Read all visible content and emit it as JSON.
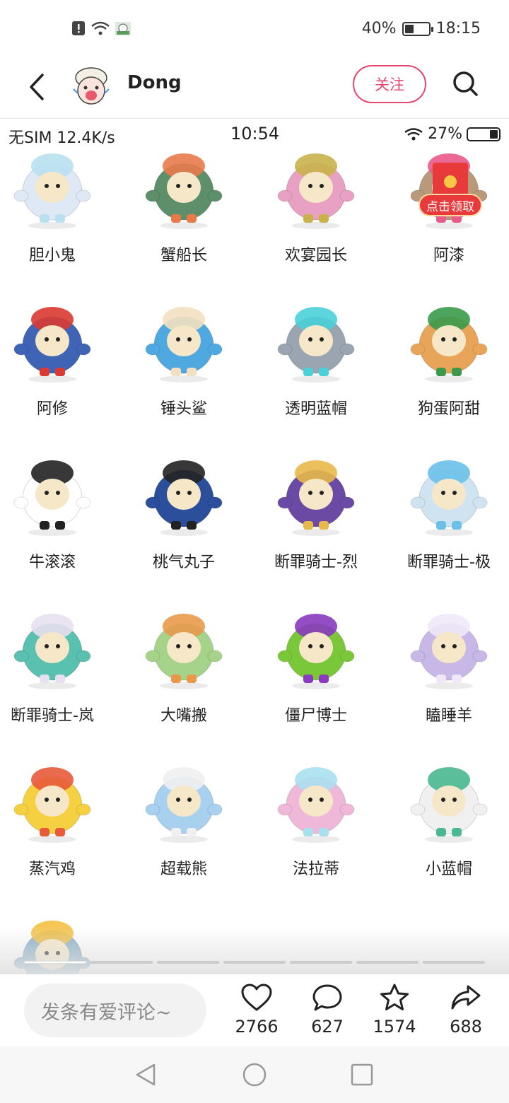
{
  "status_bar": {
    "battery": "40%",
    "time": "18:15",
    "battery_level": 0.4,
    "icons": [
      "alert-icon",
      "wifi-icon",
      "app-notification-icon"
    ]
  },
  "header": {
    "username": "Dong",
    "follow_label": "关注"
  },
  "inner_status": {
    "carrier": "无SIM 12.4K/s",
    "time": "10:54",
    "battery": "27%",
    "battery_level": 0.27
  },
  "characters": [
    {
      "name": "胆小鬼",
      "color": "#dfe9f5",
      "accent": "#b8e0ef"
    },
    {
      "name": "蟹船长",
      "color": "#5d8f6a",
      "accent": "#e87a4a"
    },
    {
      "name": "欢宴园长",
      "color": "#e8a1c3",
      "accent": "#c9b24a"
    },
    {
      "name": "阿漆",
      "color": "#b89a7a",
      "accent": "#e85a8a"
    },
    {
      "name": "阿修",
      "color": "#3f63b5",
      "accent": "#d93a32"
    },
    {
      "name": "锤头鲨",
      "color": "#4fa8e0",
      "accent": "#f3e0c0"
    },
    {
      "name": "透明蓝帽",
      "color": "#9aa5b1",
      "accent": "#4ad0d8"
    },
    {
      "name": "狗蛋阿甜",
      "color": "#e8a55a",
      "accent": "#3a9a4a"
    },
    {
      "name": "牛滚滚",
      "color": "#ffffff",
      "accent": "#222222"
    },
    {
      "name": "桃气丸子",
      "color": "#2b4f9a",
      "accent": "#222222"
    },
    {
      "name": "断罪骑士-烈",
      "color": "#6a4aa5",
      "accent": "#e8b84a"
    },
    {
      "name": "断罪骑士-极",
      "color": "#cfe3f0",
      "accent": "#6ac0e8"
    },
    {
      "name": "断罪骑士-岚",
      "color": "#5ac0b0",
      "accent": "#e8e0f0"
    },
    {
      "name": "大嘴搬",
      "color": "#a5d38a",
      "accent": "#e89a4a"
    },
    {
      "name": "僵尸博士",
      "color": "#7ac83a",
      "accent": "#8a3ac0"
    },
    {
      "name": "瞌睡羊",
      "color": "#c8b8e8",
      "accent": "#f0e8f8"
    },
    {
      "name": "蒸汽鸡",
      "color": "#f5d040",
      "accent": "#e85a3a"
    },
    {
      "name": "超载熊",
      "color": "#a8d0ef",
      "accent": "#f0f0f0"
    },
    {
      "name": "法拉蒂",
      "color": "#f0b8d8",
      "accent": "#a8e0f0"
    },
    {
      "name": "小蓝帽",
      "color": "#f0f0f0",
      "accent": "#4ab890"
    },
    {
      "name": "",
      "color": "#8ab0c8",
      "accent": "#f5c040"
    }
  ],
  "red_packet_label": "点击领取",
  "image_carousel": {
    "pages": 7,
    "current": 1
  },
  "actions": {
    "comment_placeholder": "发条有爱评论~",
    "likes": "2766",
    "comments": "627",
    "favorites": "1574",
    "shares": "688"
  },
  "colors": {
    "accent": "#e8456b",
    "text": "#222222"
  }
}
